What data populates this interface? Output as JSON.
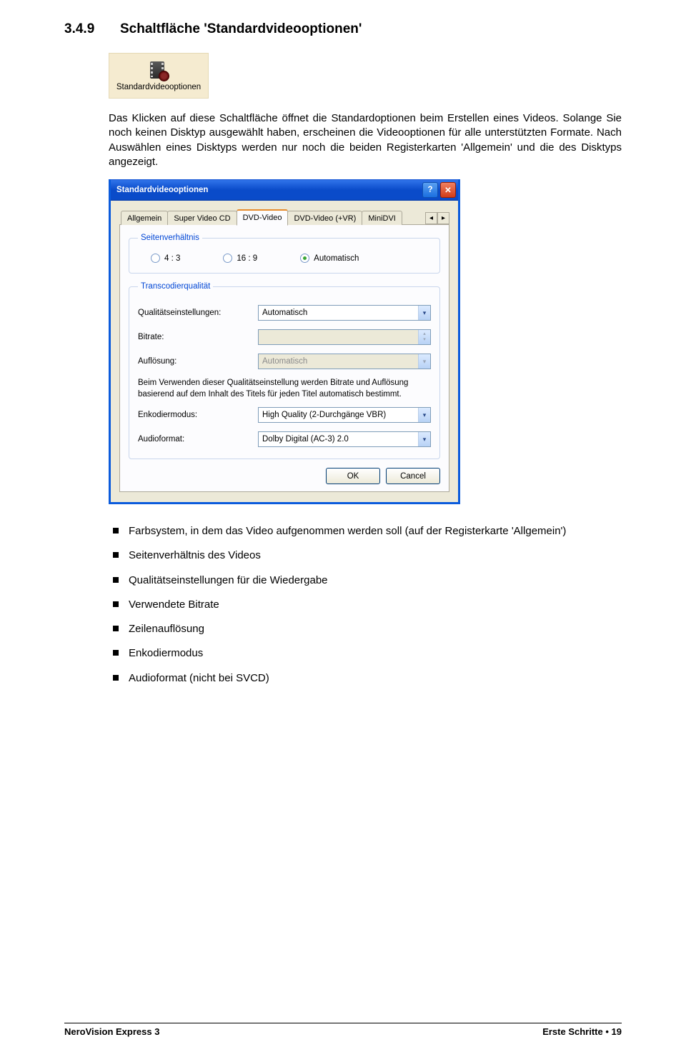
{
  "section": {
    "number": "3.4.9",
    "title": "Schaltfläche 'Standardvideooptionen'"
  },
  "toolbar_button": {
    "label": "Standardvideooptionen"
  },
  "paragraph1": "Das Klicken auf diese Schaltfläche öffnet die Standardoptionen beim Erstellen eines Videos. Solange Sie noch keinen Disktyp ausgewählt haben, erscheinen die Videooptionen für alle unterstützten Formate. Nach Auswählen eines Disktyps werden nur noch die beiden Registerkarten 'Allgemein' und die des Disktyps angezeigt.",
  "dialog": {
    "title": "Standardvideooptionen",
    "tabs": [
      "Allgemein",
      "Super Video CD",
      "DVD-Video",
      "DVD-Video (+VR)",
      "MiniDVI"
    ],
    "active_tab_index": 2,
    "group_aspect": {
      "legend": "Seitenverhältnis",
      "options": [
        {
          "label": "4 : 3",
          "checked": false
        },
        {
          "label": "16 : 9",
          "checked": false
        },
        {
          "label": "Automatisch",
          "checked": true
        }
      ]
    },
    "group_quality": {
      "legend": "Transcodierqualität",
      "quality_label": "Qualitätseinstellungen:",
      "quality_value": "Automatisch",
      "bitrate_label": "Bitrate:",
      "bitrate_value": "",
      "resolution_label": "Auflösung:",
      "resolution_value": "Automatisch",
      "note": "Beim Verwenden dieser Qualitätseinstellung werden Bitrate und Auflösung basierend auf dem Inhalt des Titels für jeden Titel automatisch bestimmt.",
      "encode_label": "Enkodiermodus:",
      "encode_value": "High Quality (2-Durchgänge VBR)",
      "audio_label": "Audioformat:",
      "audio_value": "Dolby Digital (AC-3) 2.0"
    },
    "ok": "OK",
    "cancel": "Cancel"
  },
  "bullets": {
    "b1a": "Farbsystem, in dem das Video aufgenommen werden soll (auf der Registerkarte 'Allgemein')",
    "b2": "Seitenverhältnis des Videos",
    "b3": "Qualitätseinstellungen für die Wiedergabe",
    "b4": "Verwendete Bitrate",
    "b5": "Zeilenauflösung",
    "b6": "Enkodiermodus",
    "b7": "Audioformat (nicht bei SVCD)"
  },
  "footer": {
    "left": "NeroVision Express 3",
    "right_label": "Erste Schritte",
    "right_page": "19"
  }
}
